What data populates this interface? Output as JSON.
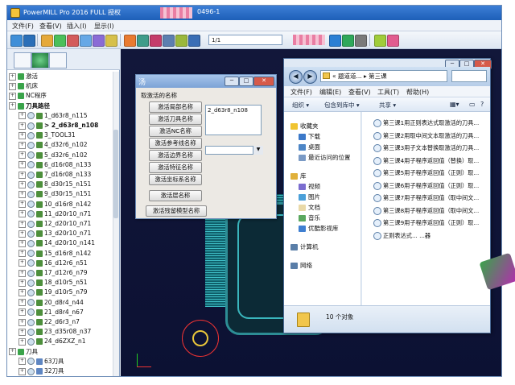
{
  "powermill": {
    "title": "PowerMILL Pro 2016 FULL 授权",
    "project": "0496-1",
    "menu": [
      "文件(F)",
      "查看(V)",
      "插入(I)",
      "显示(I)"
    ],
    "toolbar_combo": "1/1",
    "explorer_items": [
      {
        "label": "激活",
        "level": 0,
        "kind": "folder"
      },
      {
        "label": "机床",
        "level": 0,
        "kind": "folder"
      },
      {
        "label": "NC程序",
        "level": 0,
        "kind": "folder"
      },
      {
        "label": "刀具路径",
        "level": 0,
        "kind": "folder",
        "bold": true
      },
      {
        "label": "1_d63r8_n115",
        "level": 1,
        "kind": "path"
      },
      {
        "label": "> 2_d63r8_n108",
        "level": 1,
        "kind": "path",
        "bold": true
      },
      {
        "label": "3_TOOL31",
        "level": 1,
        "kind": "path"
      },
      {
        "label": "4_d32r6_n102",
        "level": 1,
        "kind": "path"
      },
      {
        "label": "5_d32r6_n102",
        "level": 1,
        "kind": "path"
      },
      {
        "label": "6_d16r08_n133",
        "level": 1,
        "kind": "path"
      },
      {
        "label": "7_d16r08_n133",
        "level": 1,
        "kind": "path"
      },
      {
        "label": "8_d30r15_n151",
        "level": 1,
        "kind": "path"
      },
      {
        "label": "9_d30r15_n151",
        "level": 1,
        "kind": "path"
      },
      {
        "label": "10_d16r8_n142",
        "level": 1,
        "kind": "path"
      },
      {
        "label": "11_d20r10_n71",
        "level": 1,
        "kind": "path"
      },
      {
        "label": "12_d20r10_n71",
        "level": 1,
        "kind": "path"
      },
      {
        "label": "13_d20r10_n71",
        "level": 1,
        "kind": "path"
      },
      {
        "label": "14_d20r10_n141",
        "level": 1,
        "kind": "path"
      },
      {
        "label": "15_d16r8_n142",
        "level": 1,
        "kind": "path"
      },
      {
        "label": "16_d12r6_n51",
        "level": 1,
        "kind": "path"
      },
      {
        "label": "17_d12r6_n79",
        "level": 1,
        "kind": "path"
      },
      {
        "label": "18_d10r5_n51",
        "level": 1,
        "kind": "path"
      },
      {
        "label": "19_d10r5_n79",
        "level": 1,
        "kind": "path"
      },
      {
        "label": "20_d8r4_n44",
        "level": 1,
        "kind": "path"
      },
      {
        "label": "21_d8r4_n67",
        "level": 1,
        "kind": "path"
      },
      {
        "label": "22_d6r3_n7",
        "level": 1,
        "kind": "path"
      },
      {
        "label": "23_d35r08_n37",
        "level": 1,
        "kind": "path"
      },
      {
        "label": "24_d6ZXZ_n1",
        "level": 1,
        "kind": "path"
      },
      {
        "label": "刀具",
        "level": 0,
        "kind": "folder"
      },
      {
        "label": "63刀具",
        "level": 1,
        "kind": "tool"
      },
      {
        "label": "32刀具",
        "level": 1,
        "kind": "tool"
      }
    ]
  },
  "dialog": {
    "icon": "汤",
    "label": "取激活的名称",
    "buttons": [
      "激活局部名称",
      "激活刀具名称",
      "激活NC名称",
      "激活参考线名称",
      "激活边界名称",
      "激活特征名称",
      "激活坐标系名称",
      "激活层名称",
      "激活残留模型名称"
    ],
    "text_value": "2_d63r8_n108",
    "select_value": ""
  },
  "window": {
    "address": [
      "« 题道道...",
      "第三课"
    ],
    "menu": [
      "文件(F)",
      "编辑(E)",
      "查看(V)",
      "工具(T)",
      "帮助(H)"
    ],
    "commands": [
      "组织 ▾",
      "包含到库中 ▾",
      "共享 ▾",
      "新建文件夹"
    ],
    "nav": [
      {
        "label": "收藏夹",
        "group": true,
        "color": "#f0c431"
      },
      {
        "label": "下载",
        "group": false,
        "color": "#3c79c9"
      },
      {
        "label": "桌面",
        "group": false,
        "color": "#4d86c6"
      },
      {
        "label": "最近访问的位置",
        "group": false,
        "color": "#7a9ac5"
      },
      {
        "label": "库",
        "group": true,
        "color": "#e0b03a"
      },
      {
        "label": "视频",
        "group": false,
        "color": "#7b6dcf"
      },
      {
        "label": "图片",
        "group": false,
        "color": "#4ba0d9"
      },
      {
        "label": "文档",
        "group": false,
        "color": "#e9d9a8"
      },
      {
        "label": "音乐",
        "group": false,
        "color": "#5aa85f"
      },
      {
        "label": "优酷影视库",
        "group": false,
        "color": "#3f7fd1"
      },
      {
        "label": "计算机",
        "group": true,
        "color": "#5a7ea8"
      },
      {
        "label": "网络",
        "group": true,
        "color": "#5a7ea8"
      }
    ],
    "files": [
      "第三课1用正则表达式取激活的刀具...",
      "第三课2用取中间文本取激活的刀具...",
      "第三课3用子文本替换取激活的刀具...",
      "第三课4用子程序返回值（替换）取...",
      "第三课5用子程序返回值（正则）取...",
      "第三课6用子程序返回值（正则）取...",
      "第三课7用子程序返回值（取中间文...",
      "第三课8用子程序返回值（取中间文...",
      "第三课9用子程序返回值（正则）取...",
      "正则表达式...       ...器"
    ],
    "status": "10 个对象"
  }
}
